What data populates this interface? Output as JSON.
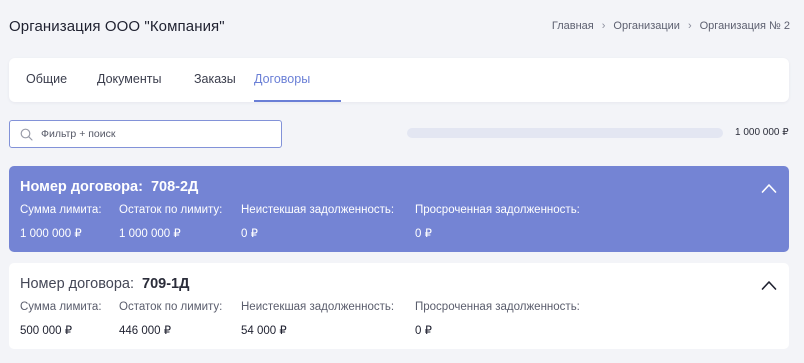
{
  "header": {
    "title": "Организация ООО \"Компания\"",
    "breadcrumb": [
      "Главная",
      "Организации",
      "Организация № 2"
    ]
  },
  "tabs": [
    {
      "label": "Общие",
      "active": false
    },
    {
      "label": "Документы",
      "active": false
    },
    {
      "label": "Заказы",
      "active": false
    },
    {
      "label": "Договоры",
      "active": true
    }
  ],
  "filter": {
    "placeholder": "Фильтр + поиск",
    "value": ""
  },
  "limit_bar": {
    "label": "1 000 000 ₽",
    "fill_fraction": 0.0
  },
  "colors": {
    "accent": "#7484d4",
    "active_tab": "#6a7fd6",
    "background": "#f3f4f8"
  },
  "contracts": [
    {
      "title_label": "Номер договора:",
      "number": "708-2Д",
      "expanded": true,
      "fields": [
        {
          "label": "Сумма лимита:",
          "value": "1 000 000 ₽"
        },
        {
          "label": "Остаток по лимиту:",
          "value": "1 000 000 ₽"
        },
        {
          "label": "Неистекшая задолженность:",
          "value": "0 ₽"
        },
        {
          "label": "Просроченная задолженность:",
          "value": "0 ₽"
        }
      ]
    },
    {
      "title_label": "Номер договора:",
      "number": "709-1Д",
      "expanded": false,
      "fields": [
        {
          "label": "Сумма лимита:",
          "value": "500 000 ₽"
        },
        {
          "label": "Остаток по лимиту:",
          "value": "446 000 ₽"
        },
        {
          "label": "Неистекшая задолженность:",
          "value": "54 000 ₽"
        },
        {
          "label": "Просроченная задолженность:",
          "value": "0 ₽"
        }
      ]
    }
  ]
}
